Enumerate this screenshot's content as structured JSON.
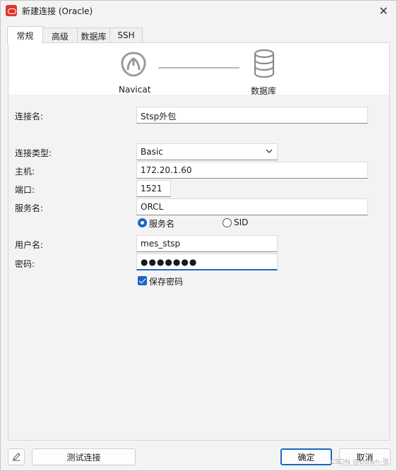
{
  "window": {
    "title": "新建连接 (Oracle)"
  },
  "tabs": [
    {
      "label": "常规"
    },
    {
      "label": "高级"
    },
    {
      "label": "数据库"
    },
    {
      "label": "SSH"
    }
  ],
  "banner": {
    "left_label": "Navicat",
    "right_label": "数据库"
  },
  "form": {
    "connection_name_label": "连接名:",
    "connection_name_value": "Stsp外包",
    "connection_type_label": "连接类型:",
    "connection_type_value": "Basic",
    "host_label": "主机:",
    "host_value": "172.20.1.60",
    "port_label": "端口:",
    "port_value": "1521",
    "service_label": "服务名:",
    "service_value": "ORCL",
    "radio_service_label": "服务名",
    "radio_sid_label": "SID",
    "user_label": "用户名:",
    "user_value": "mes_stsp",
    "password_label": "密码:",
    "password_value": "●●●●●●●",
    "save_password_label": "保存密码"
  },
  "footer": {
    "test_button": "测试连接",
    "ok_button": "确定",
    "cancel_button": "取消"
  },
  "watermark": "CSDN @Dawn-张"
}
